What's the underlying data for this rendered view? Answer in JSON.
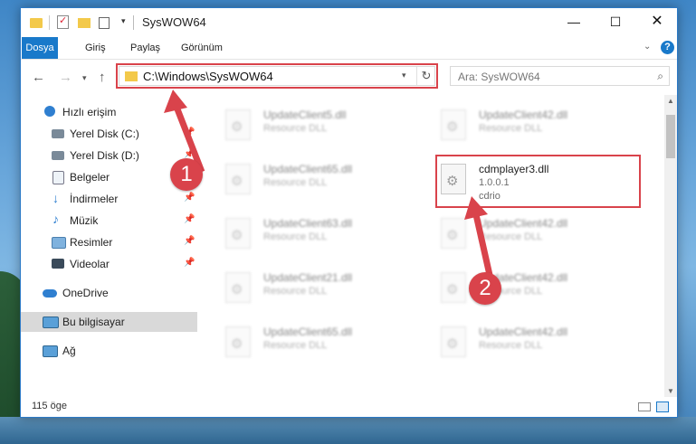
{
  "window": {
    "title": "SysWOW64",
    "minimize": "—",
    "maximize": "☐",
    "close": "✕"
  },
  "ribbon": {
    "tabs": [
      "Dosya",
      "Giriş",
      "Paylaş",
      "Görünüm"
    ],
    "active_tab": "Dosya",
    "help": "?",
    "accent": "#1979ca"
  },
  "nav": {
    "back": "←",
    "forward": "→",
    "recent": "▾",
    "up": "↑",
    "address": "C:\\Windows\\SysWOW64",
    "refresh": "↻",
    "search_placeholder": "Ara: SysWOW64"
  },
  "sidebar": {
    "items": [
      {
        "label": "Hızlı erişim",
        "icon": "star-icon",
        "pinned": false
      },
      {
        "label": "Yerel Disk (C:)",
        "icon": "drive-icon",
        "pinned": true
      },
      {
        "label": "Yerel Disk (D:)",
        "icon": "drive-icon",
        "pinned": true
      },
      {
        "label": "Belgeler",
        "icon": "documents-icon",
        "pinned": true
      },
      {
        "label": "İndirmeler",
        "icon": "download-icon",
        "pinned": true
      },
      {
        "label": "Müzik",
        "icon": "music-icon",
        "pinned": true
      },
      {
        "label": "Resimler",
        "icon": "pictures-icon",
        "pinned": true
      },
      {
        "label": "Videolar",
        "icon": "videos-icon",
        "pinned": true
      },
      {
        "label": "OneDrive",
        "icon": "cloud-icon",
        "pinned": false
      },
      {
        "label": "Bu bilgisayar",
        "icon": "computer-icon",
        "pinned": false
      },
      {
        "label": "Ağ",
        "icon": "network-icon",
        "pinned": false
      }
    ],
    "selected": "Bu bilgisayar"
  },
  "files": {
    "items": [
      {
        "name": "UpdateClient5.dll",
        "line2": "Resource DLL",
        "line3": ""
      },
      {
        "name": "UpdateClient42.dll",
        "line2": "Resource DLL",
        "line3": ""
      },
      {
        "name": "UpdateClient65.dll",
        "line2": "Resource DLL",
        "line3": ""
      },
      {
        "name": "cdmplayer3.dll",
        "line2": "1.0.0.1",
        "line3": "cdrio"
      },
      {
        "name": "UpdateClient63.dll",
        "line2": "Resource DLL",
        "line3": ""
      },
      {
        "name": "UpdateClient42.dll",
        "line2": "Resource DLL",
        "line3": ""
      },
      {
        "name": "UpdateClient21.dll",
        "line2": "Resource DLL",
        "line3": ""
      },
      {
        "name": "UpdateClient42.dll",
        "line2": "Resource DLL",
        "line3": ""
      },
      {
        "name": "UpdateClient65.dll",
        "line2": "Resource DLL",
        "line3": ""
      },
      {
        "name": "UpdateClient42.dll",
        "line2": "Resource DLL",
        "line3": ""
      }
    ]
  },
  "status": {
    "count": "115 öge"
  },
  "annotations": {
    "step1": "1",
    "step2": "2",
    "color": "#d9434b"
  }
}
